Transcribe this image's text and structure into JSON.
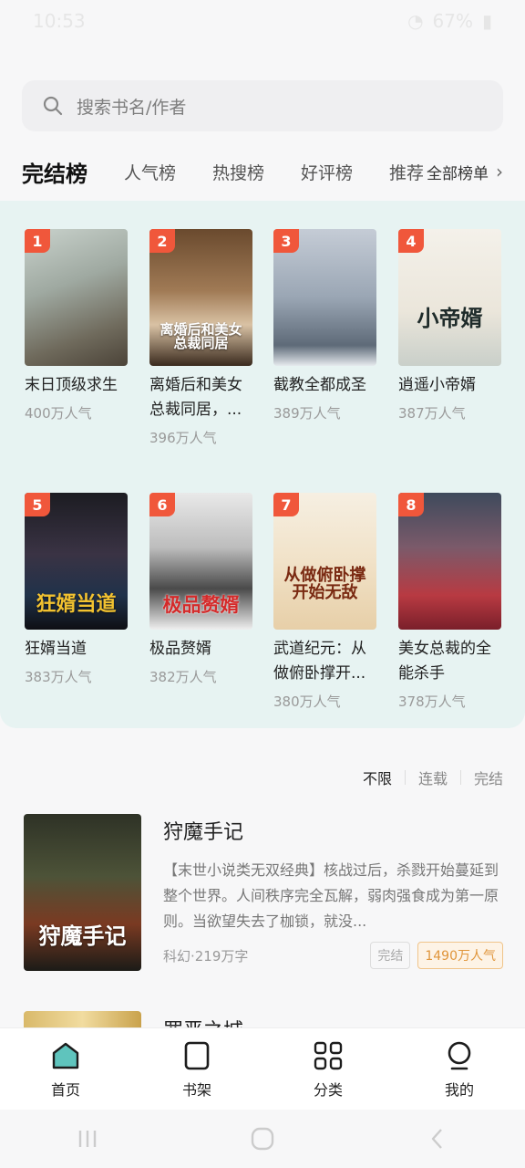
{
  "status": {
    "time": "10:53",
    "battery": "67%"
  },
  "search": {
    "placeholder": "搜索书名/作者"
  },
  "tabs": [
    {
      "label": "完结榜"
    },
    {
      "label": "人气榜"
    },
    {
      "label": "热搜榜"
    },
    {
      "label": "好评榜"
    },
    {
      "label": "推荐榜"
    }
  ],
  "all_lists_label": "全部榜单",
  "ranking": [
    {
      "rank": "1",
      "title": "末日顶级求生",
      "popularity": "400万人气",
      "cover_text": ""
    },
    {
      "rank": "2",
      "title": "离婚后和美女总裁同居，...",
      "popularity": "396万人气",
      "cover_text": "离婚后和美女总裁同居"
    },
    {
      "rank": "3",
      "title": "截教全都成圣",
      "popularity": "389万人气",
      "cover_text": ""
    },
    {
      "rank": "4",
      "title": "逍遥小帝婿",
      "popularity": "387万人气",
      "cover_text": "小帝婿"
    },
    {
      "rank": "5",
      "title": "狂婿当道",
      "popularity": "383万人气",
      "cover_text": "狂婿当道"
    },
    {
      "rank": "6",
      "title": "极品赘婿",
      "popularity": "382万人气",
      "cover_text": "极品赘婿"
    },
    {
      "rank": "7",
      "title": "武道纪元：从做俯卧撑开...",
      "popularity": "380万人气",
      "cover_text": "从做俯卧撑开始无敌"
    },
    {
      "rank": "8",
      "title": "美女总裁的全能杀手",
      "popularity": "378万人气",
      "cover_text": ""
    }
  ],
  "filters": [
    {
      "label": "不限"
    },
    {
      "label": "连载"
    },
    {
      "label": "完结"
    }
  ],
  "list": [
    {
      "title": "狩魔手记",
      "description": "【末世小说类无双经典】核战过后，杀戮开始蔓延到整个世界。人间秩序完全瓦解，弱肉强食成为第一原则。当欲望失去了枷锁，就没...",
      "genre": "科幻·219万字",
      "status": "完结",
      "popularity": "1490万人气",
      "cover_text": "狩魔手记"
    },
    {
      "title": "罪恶之城"
    }
  ],
  "bottom_nav": [
    {
      "label": "首页"
    },
    {
      "label": "书架"
    },
    {
      "label": "分类"
    },
    {
      "label": "我的"
    }
  ],
  "colors": {
    "accent": "#f0573b",
    "panel": "#e7f3f2",
    "popularity_tag": "#e0953a",
    "home_icon": "#5fc4bd"
  }
}
